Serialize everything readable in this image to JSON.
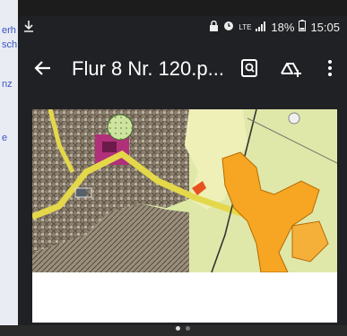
{
  "background_page": {
    "fragments": [
      "erh",
      "sch",
      "nz",
      "e"
    ]
  },
  "status_bar": {
    "network": "LTE",
    "battery": "18%",
    "time": "15:05"
  },
  "app_bar": {
    "title": "Flur 8 Nr. 120.p..."
  },
  "document": {
    "page_count_indicator": [
      true,
      false
    ]
  }
}
